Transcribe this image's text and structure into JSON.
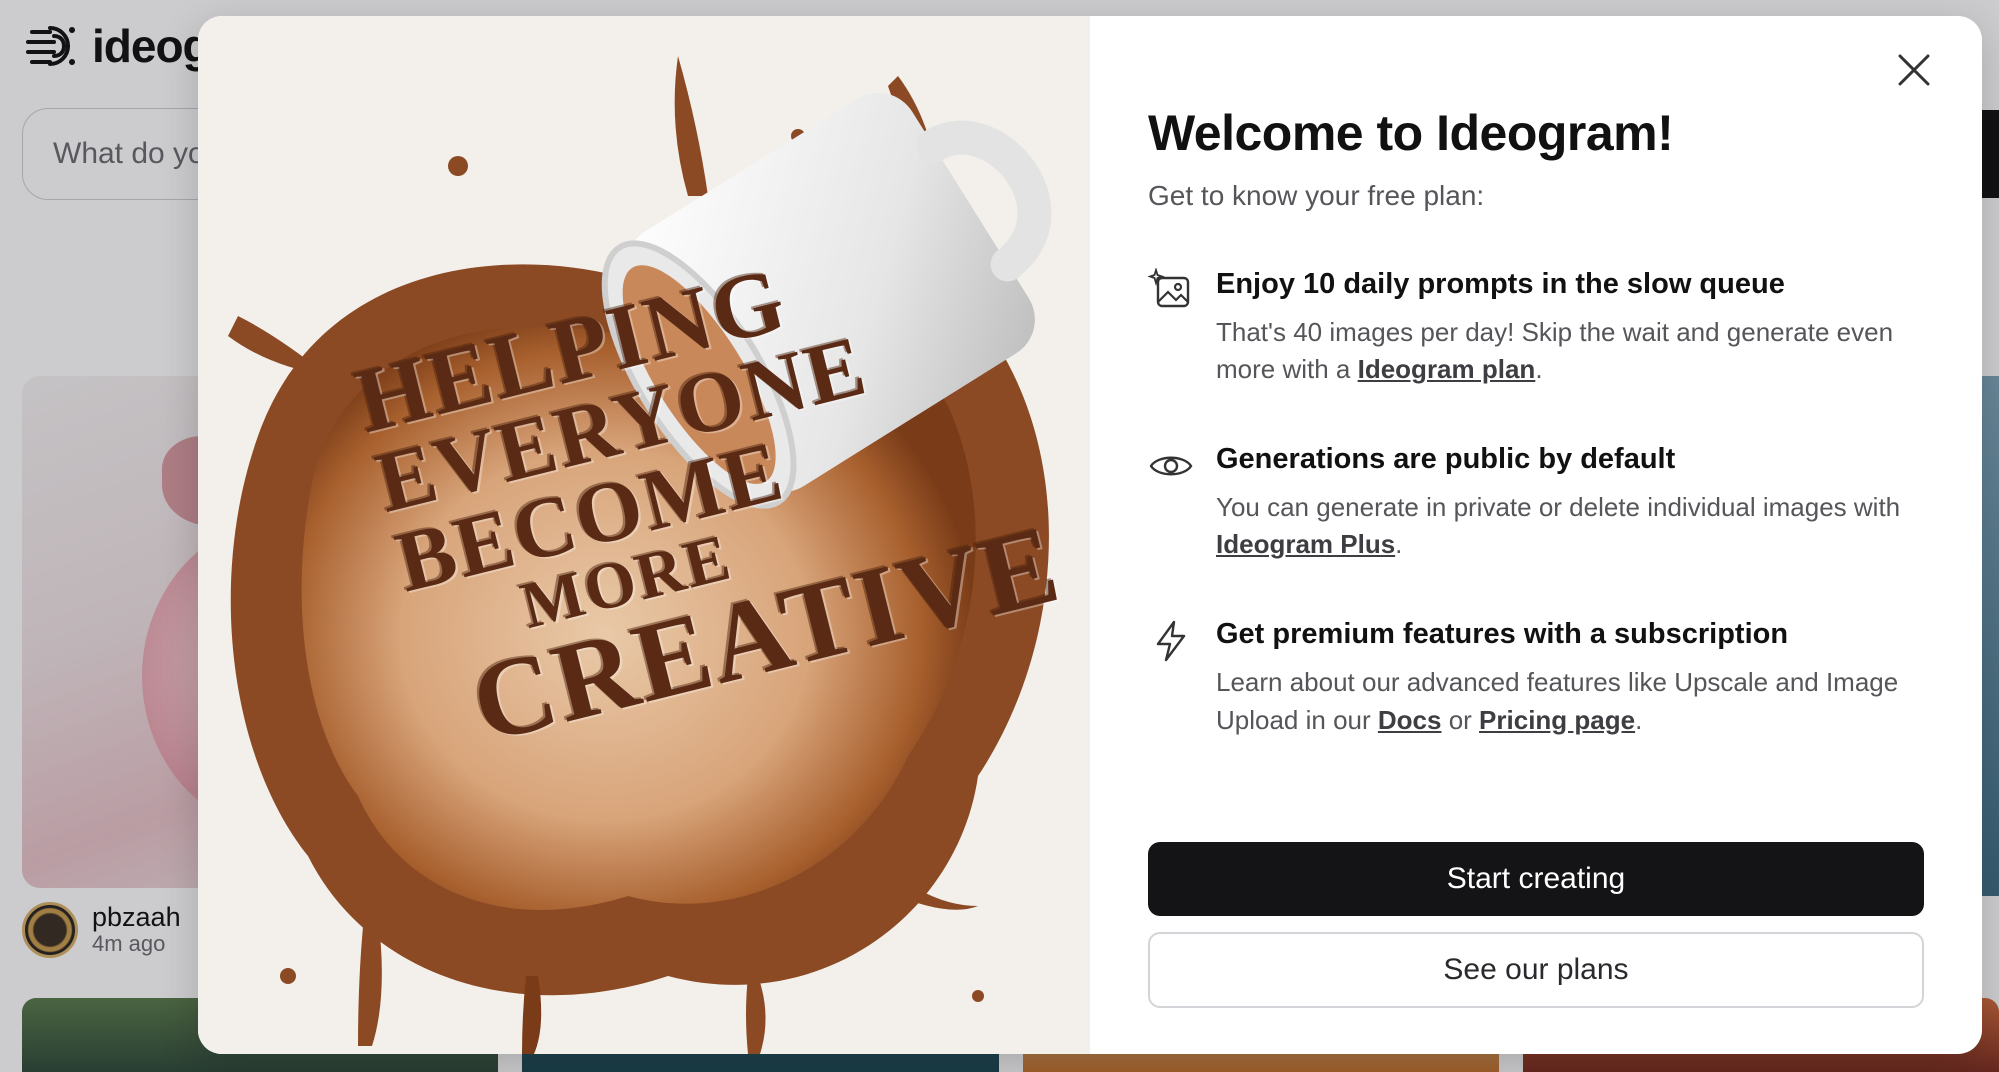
{
  "app": {
    "logo_text": "ideog",
    "logo_icon": "ideogram-brain-icon"
  },
  "background": {
    "search_placeholder": "What do yo",
    "generate_peek": "n",
    "feed_card": {
      "author": "pbzaah",
      "time": "4m ago"
    }
  },
  "modal": {
    "art": {
      "lines": [
        "HELPING",
        "EVERYONE",
        "BECOME",
        "MORE",
        "CREATIVE"
      ]
    },
    "title": "Welcome to Ideogram!",
    "subtitle": "Get to know your free plan:",
    "close_icon": "close-icon",
    "features": [
      {
        "icon": "sparkle-image-icon",
        "title": "Enjoy 10 daily prompts in the slow queue",
        "desc_before": "That's 40 images per day! Skip the wait and generate even more with a ",
        "link1": "Ideogram plan",
        "desc_after": "."
      },
      {
        "icon": "eye-icon",
        "title": "Generations are public by default",
        "desc_before": "You can generate in private or delete individual images with ",
        "link1": "Ideogram Plus",
        "desc_after": "."
      },
      {
        "icon": "lightning-icon",
        "title": "Get premium features with a subscription",
        "desc_before": "Learn about our advanced features like Upscale and Image Upload in our ",
        "link1": "Docs",
        "desc_middle": " or ",
        "link2": "Pricing page",
        "desc_after": "."
      }
    ],
    "primary_button": "Start creating",
    "secondary_button": "See our plans"
  },
  "colors": {
    "primary_button_bg": "#141416",
    "text_primary": "#111111",
    "text_secondary": "#55555a",
    "coffee": "#8b4a24"
  }
}
